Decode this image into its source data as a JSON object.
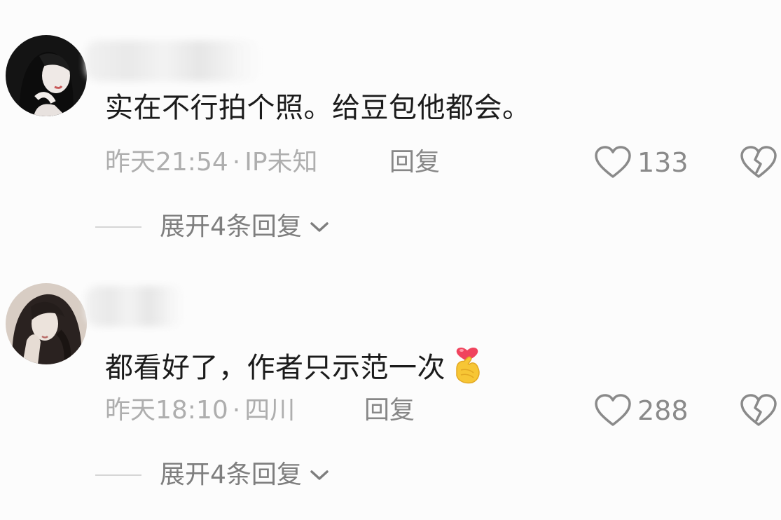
{
  "comments": [
    {
      "text": "实在不行拍个照。给豆包他都会。",
      "time": "昨天21:54",
      "separator": "·",
      "location": "IP未知",
      "reply_label": "回复",
      "likes": "133",
      "expand_label": "展开4条回复",
      "has_emoji": false
    },
    {
      "text": "都看好了，作者只示范一次",
      "time": "昨天18:10",
      "separator": "·",
      "location": "四川",
      "reply_label": "回复",
      "likes": "288",
      "expand_label": "展开4条回复",
      "has_emoji": true,
      "emoji": "finger-heart-emoji"
    }
  ],
  "colors": {
    "background": "#fcfcfc",
    "text": "#1b1b1b",
    "meta": "#aeaeae",
    "icon": "#8a8a8a"
  }
}
